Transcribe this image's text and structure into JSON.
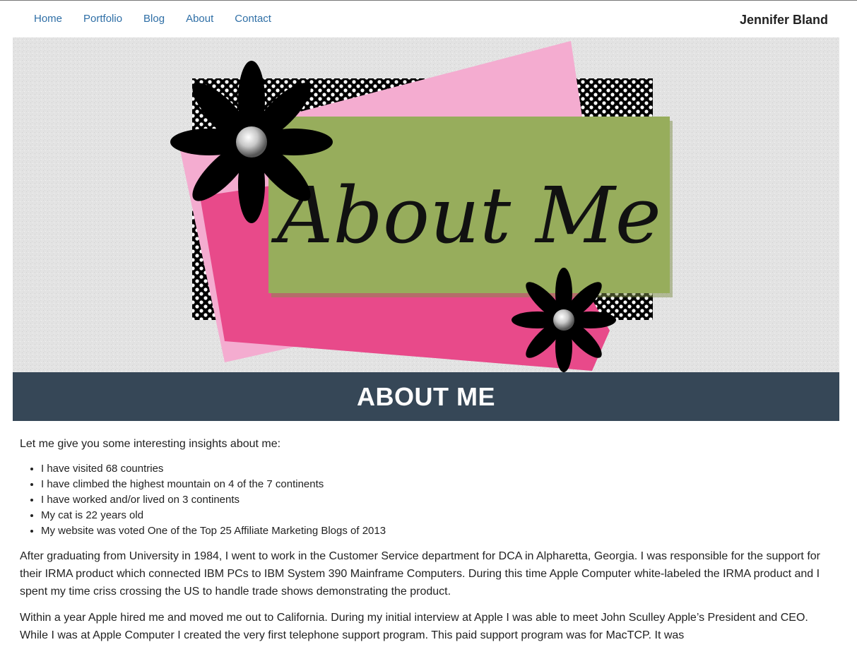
{
  "nav": {
    "links": [
      "Home",
      "Portfolio",
      "Blog",
      "About",
      "Contact"
    ],
    "brand": "Jennifer Bland"
  },
  "hero": {
    "image_text": "About Me"
  },
  "page_title": "ABOUT ME",
  "content": {
    "intro": "Let me give you some interesting insights about me:",
    "facts": [
      "I have visited 68 countries",
      "I have climbed the highest mountain on 4 of the 7 continents",
      "I have worked and/or lived on 3 continents",
      "My cat is 22 years old",
      "My website was voted One of the Top 25 Affiliate Marketing Blogs of 2013"
    ],
    "paragraph1": "After graduating from University in 1984, I went to work in the Customer Service department for DCA in Alpharetta, Georgia. I was responsible for the support for their IRMA product which connected IBM PCs to IBM System 390 Mainframe Computers. During this time Apple Computer white-labeled the IRMA product and I spent my time criss crossing the US to handle trade shows demonstrating the product.",
    "paragraph2": "Within a year Apple hired me and moved me out to California. During my initial interview at Apple I was able to meet John Sculley Apple’s President and CEO. While I was at Apple Computer I created the very first telephone support program. This paid support program was for MacTCP. It was"
  },
  "colors": {
    "nav_link": "#2f6fa6",
    "title_bar": "#364757",
    "pink_light": "#f4acd0",
    "pink_hot": "#e84a8a",
    "green": "#97ad5c"
  },
  "icons": {
    "flower_large": "black-daisy-icon",
    "flower_small": "black-daisy-icon"
  }
}
